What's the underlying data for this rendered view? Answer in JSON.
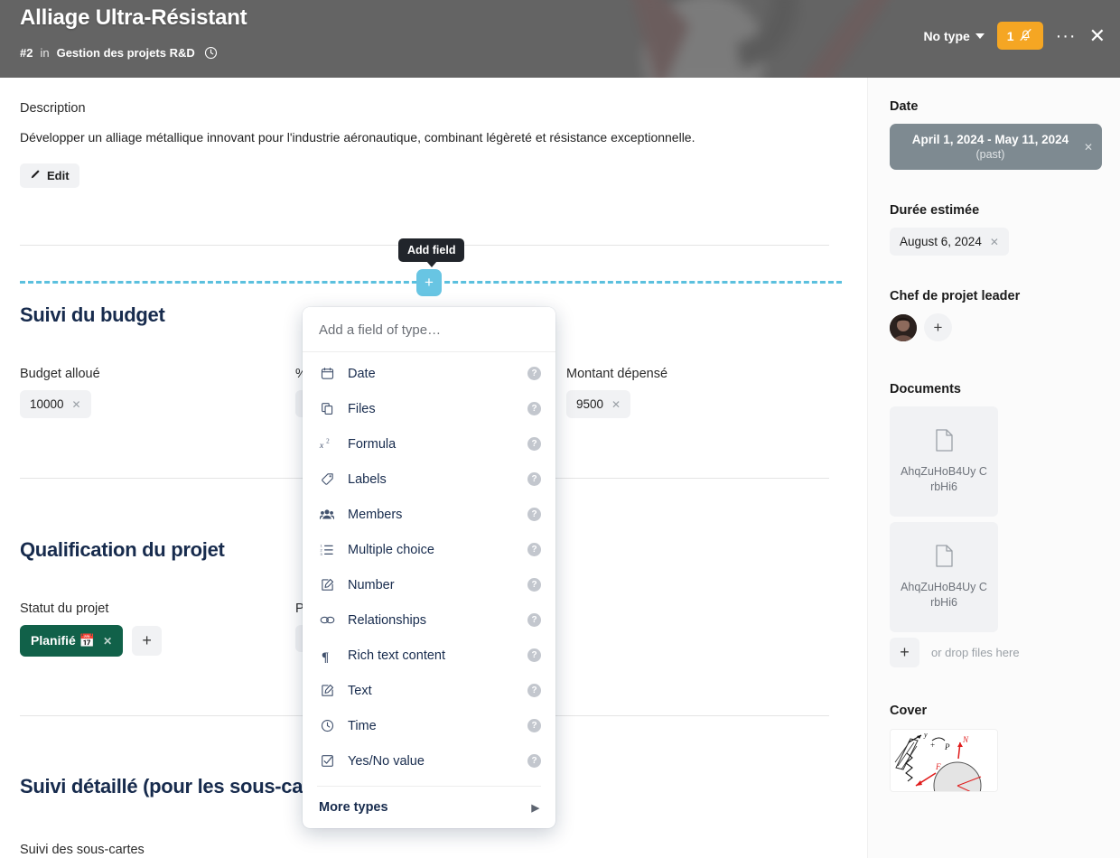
{
  "header": {
    "title": "Alliage Ultra-Résistant",
    "card_number": "#2",
    "in_word": "in",
    "board": "Gestion des projets R&D",
    "clock_icon": "clock-icon",
    "type_label": "No type",
    "notification_count": "1",
    "notification_icon": "bell-muted-icon",
    "more_icon": "ellipsis-icon",
    "close_icon": "close-icon",
    "accent_orange": "#f5a623"
  },
  "description": {
    "label": "Description",
    "text": "Développer un alliage métallique innovant pour l'industrie aéronautique, combinant légèreté et résistance exceptionnelle.",
    "edit_label": "Edit",
    "edit_icon": "pencil-icon"
  },
  "add_field": {
    "tooltip": "Add field",
    "plus_icon": "plus-icon",
    "line_color": "#5bc0de",
    "button_color": "#68c5e3"
  },
  "sections": {
    "budget": {
      "title": "Suivi du budget",
      "fields": [
        {
          "label": "Budget alloué",
          "value": "10000",
          "remove_icon": "remove-icon"
        },
        {
          "label": "%",
          "value": "",
          "remove_icon": "remove-icon"
        },
        {
          "label": "Montant dépensé",
          "value": "9500",
          "remove_icon": "remove-icon"
        }
      ]
    },
    "qualification": {
      "title": "Qualification du projet",
      "status_label": "Statut du projet",
      "status_value": "Planifié 📅",
      "status_color": "#116149",
      "status_remove_icon": "remove-icon",
      "add_icon": "plus-icon",
      "second_label": "P"
    },
    "detail": {
      "title": "Suivi détaillé (pour les sous-cartes)",
      "subfield_label": "Suivi des sous-cartes"
    }
  },
  "field_menu": {
    "placeholder": "Add a field of type…",
    "items": [
      {
        "label": "Date",
        "icon": "calendar-icon",
        "help_icon": "help-icon"
      },
      {
        "label": "Files",
        "icon": "files-icon",
        "help_icon": "help-icon"
      },
      {
        "label": "Formula",
        "icon": "formula-icon",
        "help_icon": "help-icon"
      },
      {
        "label": "Labels",
        "icon": "tag-icon",
        "help_icon": "help-icon"
      },
      {
        "label": "Members",
        "icon": "members-icon",
        "help_icon": "help-icon"
      },
      {
        "label": "Multiple choice",
        "icon": "list-icon",
        "help_icon": "help-icon"
      },
      {
        "label": "Number",
        "icon": "number-icon",
        "help_icon": "help-icon"
      },
      {
        "label": "Relationships",
        "icon": "link-icon",
        "help_icon": "help-icon"
      },
      {
        "label": "Rich text content",
        "icon": "pilcrow-icon",
        "help_icon": "help-icon"
      },
      {
        "label": "Text",
        "icon": "text-icon",
        "help_icon": "help-icon"
      },
      {
        "label": "Time",
        "icon": "clock-icon",
        "help_icon": "help-icon"
      },
      {
        "label": "Yes/No value",
        "icon": "checkbox-icon",
        "help_icon": "help-icon"
      }
    ],
    "more_label": "More types",
    "more_arrow_icon": "chevron-right-icon"
  },
  "sidebar": {
    "date": {
      "label": "Date",
      "range": "April 1, 2024 - May 11, 2024",
      "state": "(past)",
      "remove_icon": "remove-icon",
      "chip_color": "#7e8a91"
    },
    "duration": {
      "label": "Durée estimée",
      "value": "August 6, 2024",
      "remove_icon": "remove-icon"
    },
    "leader": {
      "label": "Chef de projet leader",
      "avatar_icon": "avatar",
      "add_icon": "plus-icon"
    },
    "documents": {
      "label": "Documents",
      "files": [
        {
          "name": "AhqZuHoB4Uy CrbHi6",
          "icon": "file-icon"
        },
        {
          "name": "AhqZuHoB4Uy CrbHi6",
          "icon": "file-icon"
        }
      ],
      "add_icon": "plus-icon",
      "drop_text": "or drop files here"
    },
    "cover": {
      "label": "Cover",
      "image_icon": "physics-diagram-image"
    }
  }
}
